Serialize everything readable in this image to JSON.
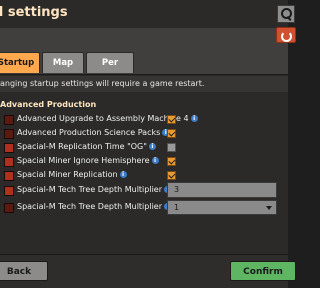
{
  "window": {
    "title": "d settings"
  },
  "tabs": [
    {
      "label": "Startup",
      "active": true
    },
    {
      "label": "Map",
      "active": false
    },
    {
      "label": "Per player",
      "active": false
    }
  ],
  "notice": "anging startup settings will require a game restart.",
  "section": {
    "title": "Advanced Production"
  },
  "settings": [
    {
      "label": "Advanced Upgrade to Assembly Machine 4",
      "info": true,
      "control": "checkbox",
      "checked": true
    },
    {
      "label": "Advanced Production Science Packs",
      "info": true,
      "control": "checkbox",
      "checked": true
    },
    {
      "label": "Spacial-M Replication Time \"OG\"",
      "info": true,
      "control": "checkbox",
      "checked": false
    },
    {
      "label": "Spacial Miner Ignore Hemisphere",
      "info": true,
      "control": "checkbox",
      "checked": true
    },
    {
      "label": "Spacial Miner Replication",
      "info": true,
      "control": "checkbox",
      "checked": true
    },
    {
      "label": "Spacial-M Tech Tree Depth Multiplier",
      "info": true,
      "control": "number",
      "value": "3"
    },
    {
      "label": "Spacial-M Tech Tree Depth Multiplier",
      "info": true,
      "control": "dropdown",
      "value": "1"
    }
  ],
  "buttons": {
    "back": "Back",
    "confirm": "Confirm"
  },
  "icons": {
    "search": "search-icon",
    "reset": "reset-icon",
    "info": "info-icon",
    "mod": "mod-icon"
  },
  "colors": {
    "accent_orange": "#ffa84e",
    "confirm_green": "#5eb663",
    "reset_red": "#d05030",
    "info_blue": "#3d7cc8"
  }
}
